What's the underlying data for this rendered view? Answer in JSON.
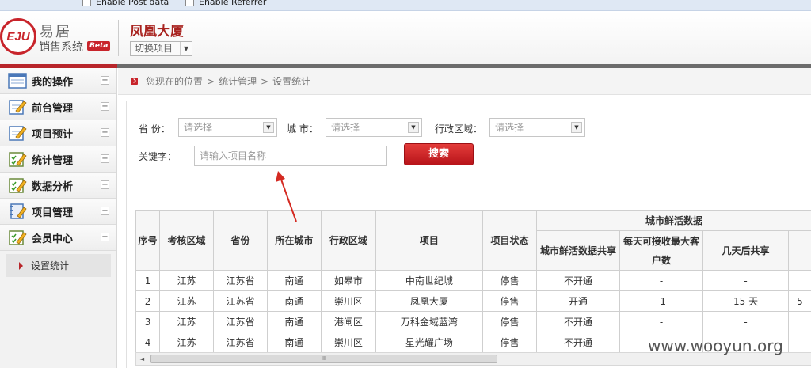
{
  "topbar": {
    "post_data_label": "Enable Post data",
    "referrer_label": "Enable Referrer"
  },
  "header": {
    "logo_text": "EJU",
    "brand_cn": "易居",
    "system_name": "销售系统",
    "beta_badge": "Beta",
    "project_name": "凤凰大厦",
    "switch_project_label": "切换项目"
  },
  "sidebar": {
    "items": [
      {
        "label": "我的操作",
        "toggle": "+"
      },
      {
        "label": "前台管理",
        "toggle": "+"
      },
      {
        "label": "项目预计",
        "toggle": "+"
      },
      {
        "label": "统计管理",
        "toggle": "+"
      },
      {
        "label": "数据分析",
        "toggle": "+"
      },
      {
        "label": "项目管理",
        "toggle": "+"
      },
      {
        "label": "会员中心",
        "toggle": "−"
      }
    ],
    "subitem": "设置统计"
  },
  "breadcrumb": {
    "prefix": "您现在的位置",
    "sep": ">",
    "level1": "统计管理",
    "level2": "设置统计"
  },
  "filters": {
    "province_label": "省 份：",
    "province_placeholder": "请选择",
    "city_label": "城 市：",
    "city_placeholder": "请选择",
    "district_label": "行政区域：",
    "district_placeholder": "请选择",
    "keyword_label": "关键字：",
    "keyword_placeholder": "请输入项目名称",
    "search_button": "搜索"
  },
  "table": {
    "headers": {
      "index": "序号",
      "region": "考核区域",
      "province": "省份",
      "city": "所在城市",
      "district": "行政区域",
      "project": "项目",
      "status": "项目状态",
      "group": "城市鲜活数据",
      "share": "城市鲜活数据共享",
      "max_clients": "每天可接收最大客户数",
      "days_after": "几天后共享"
    },
    "rows": [
      {
        "index": "1",
        "region": "江苏",
        "province": "江苏省",
        "city": "南通",
        "district": "如皋市",
        "project": "中南世纪城",
        "status": "停售",
        "share": "不开通",
        "max_clients": "-",
        "days_after": "-"
      },
      {
        "index": "2",
        "region": "江苏",
        "province": "江苏省",
        "city": "南通",
        "district": "崇川区",
        "project": "凤凰大厦",
        "status": "停售",
        "share": "开通",
        "max_clients": "-1",
        "days_after": "15 天",
        "extra": "5"
      },
      {
        "index": "3",
        "region": "江苏",
        "province": "江苏省",
        "city": "南通",
        "district": "港闸区",
        "project": "万科金域蓝湾",
        "status": "停售",
        "share": "不开通",
        "max_clients": "-",
        "days_after": "-"
      },
      {
        "index": "4",
        "region": "江苏",
        "province": "江苏省",
        "city": "南通",
        "district": "崇川区",
        "project": "星光耀广场",
        "status": "停售",
        "share": "不开通",
        "max_clients": "",
        "days_after": ""
      }
    ]
  },
  "scrollbar": {
    "left_arrow": "◄",
    "grip": "III"
  },
  "watermark": "www.wooyun.org",
  "colors": {
    "brand_red": "#c8242b",
    "button_red": "#c8181d",
    "annotation_red": "#d42a22"
  },
  "icons": {
    "nav_icon": "pencil-clipboard-icon"
  }
}
